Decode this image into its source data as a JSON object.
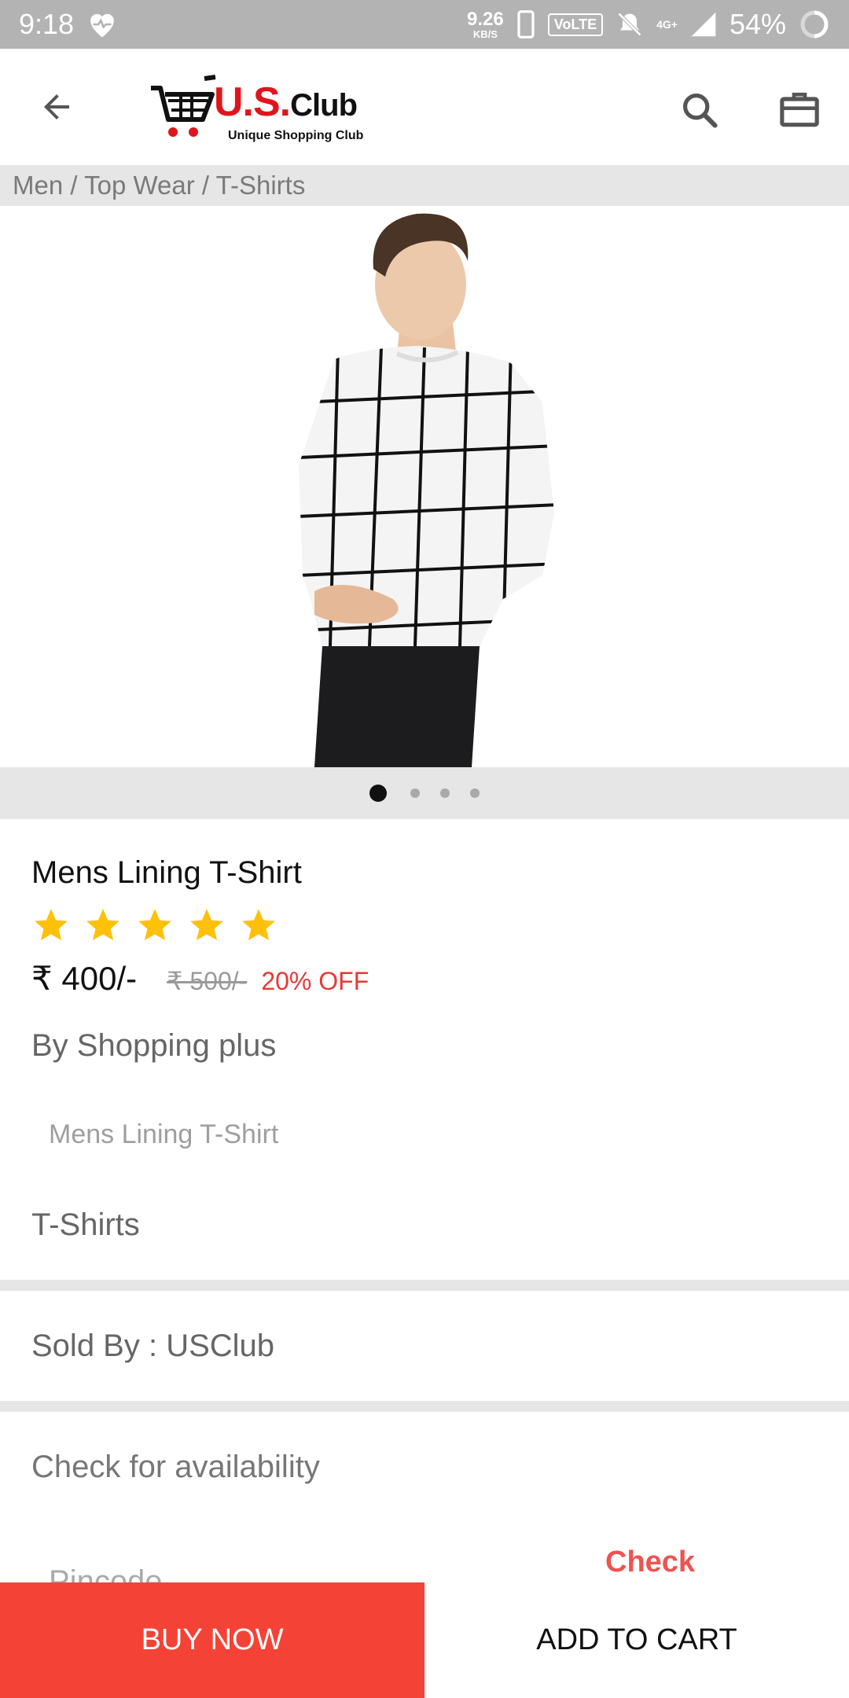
{
  "status_bar": {
    "time": "9:18",
    "net_speed": "9.26",
    "net_speed_unit": "KB/S",
    "volte": "VoLTE",
    "network_type": "4G+",
    "battery": "54%"
  },
  "header": {
    "logo_text_us": "U.S.",
    "logo_text_club": "Club",
    "logo_tagline": "Unique Shopping Club"
  },
  "breadcrumb": "Men / Top Wear / T-Shirts",
  "gallery": {
    "image_count": 4,
    "active_index": 0
  },
  "product": {
    "title": "Mens Lining T-Shirt",
    "rating": 5,
    "rating_max": 5,
    "price": "₹ 400/-",
    "mrp": "₹ 500/-",
    "discount": "20% OFF",
    "brand": "By Shopping plus",
    "description": "Mens Lining T-Shirt",
    "category": "T-Shirts"
  },
  "seller": "Sold By : USClub",
  "availability": {
    "heading": "Check for availability",
    "pincode_placeholder": "Pincode",
    "check_label": "Check"
  },
  "actions": {
    "buy_now": "BUY NOW",
    "add_to_cart": "ADD TO CART"
  },
  "colors": {
    "accent_red": "#f44336",
    "star_yellow": "#ffc107",
    "status_bar": "#b3b3b3"
  }
}
